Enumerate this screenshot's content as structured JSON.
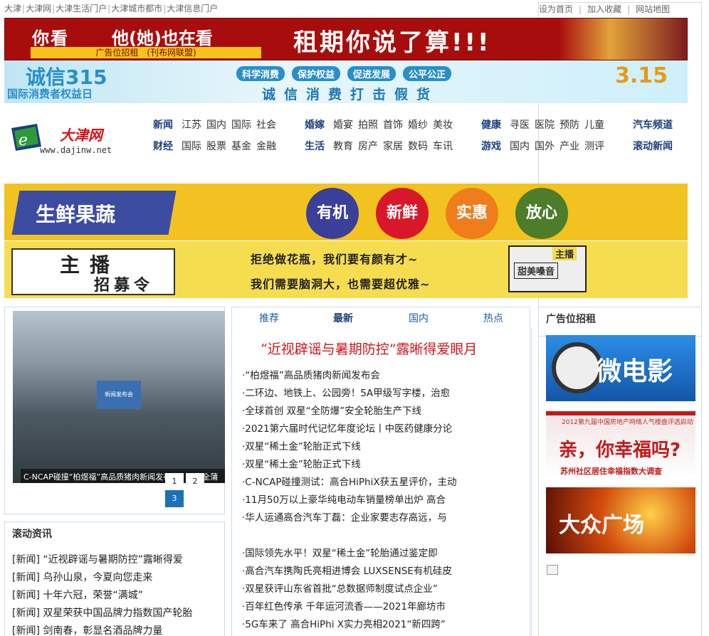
{
  "topbar": {
    "left_links": [
      "大津",
      "大津网",
      "大津生活门户",
      "大津城市都市",
      "大津信息门户"
    ],
    "right_links": [
      "设为首页",
      "加入收藏",
      "网站地图"
    ]
  },
  "banner_top": {
    "left_text_1": "你看",
    "left_text_2": "他(她)也在看",
    "ad_label": "广告位招租　(刊布网联盟)",
    "slogan": "租期你说了算!!!"
  },
  "banner_315": {
    "title": "诚信315",
    "subtitle": "国际消费者权益日",
    "pills": [
      "科学消费",
      "保护权益",
      "促进发展",
      "公平公正"
    ],
    "slogan": "诚信消费打击假货",
    "badge": "3.15"
  },
  "logo": {
    "name": "大津网",
    "url": "www.dajinw.net"
  },
  "nav": [
    {
      "rows": [
        {
          "cat": "新闻",
          "subs": [
            "江苏",
            "国内",
            "国际",
            "社会"
          ]
        },
        {
          "cat": "财经",
          "subs": [
            "国际",
            "股票",
            "基金",
            "金融"
          ]
        }
      ]
    },
    {
      "rows": [
        {
          "cat": "婚嫁",
          "subs": [
            "婚宴",
            "拍照",
            "首饰",
            "婚纱",
            "美妆"
          ]
        },
        {
          "cat": "生活",
          "subs": [
            "教育",
            "房产",
            "家居",
            "数码",
            "车讯"
          ]
        }
      ]
    },
    {
      "rows": [
        {
          "cat": "健康",
          "subs": [
            "寻医",
            "医院",
            "预防",
            "儿童"
          ]
        },
        {
          "cat": "游戏",
          "subs": [
            "国内",
            "国外",
            "产业",
            "测评"
          ]
        }
      ]
    },
    {
      "rows": [
        {
          "cat": "汽车频道",
          "subs": []
        },
        {
          "cat": "滚动新闻",
          "subs": []
        }
      ]
    }
  ],
  "banner_fresh": {
    "label": "生鲜果蔬",
    "circles": [
      "有机",
      "新鲜",
      "实惠",
      "放心"
    ]
  },
  "banner_anchor": {
    "title_1": "主播",
    "title_2": "招募令",
    "line_1": "拒绝做花瓶，我们要有颜有才~",
    "line_2": "我们需要脑洞大，也需要超优雅~",
    "tag_1": "主播",
    "tag_2": "甜美嗓音"
  },
  "slider": {
    "screen_text": "新闻发布会",
    "caption": "C-NCAP碰撞“柏煜福”高品质猪肉新闻发布会：动安全蒲",
    "dots": [
      "1",
      "2",
      "3"
    ],
    "active_dot": 3
  },
  "scroll_news": {
    "title": "滚动资讯",
    "items": [
      "[新闻] “近视辟谣与暑期防控”露晰得爱",
      "[新闻] 乌孙山泉，今夏向您走来",
      "[新闻] 十年六冠，荣誉“满城”",
      "[新闻] 双星荣获中国品牌力指数国产轮胎",
      "[新闻] 剑南春，彰显名酒品牌力量"
    ]
  },
  "center": {
    "tabs": [
      "推荐",
      "最新",
      "国内",
      "热点"
    ],
    "active_tab": 1,
    "headline": "“近视辟谣与暑期防控”露晰得爱眼月",
    "news_1": [
      "·“柏煜福”高品质猪肉新闻发布会",
      "·二环边、地铁上、公园旁！5A甲级写字楼，治愈",
      "·全球首创 双星“全防爆”安全轮胎生产下线",
      "·2021第六届时代记忆年度论坛丨中医药健康分论",
      "·双星“稀土金”轮胎正式下线",
      "·双星“稀土金”轮胎正式下线",
      "·C-NCAP碰撞测试：高合HiPhiX获五星评价，主动",
      "·11月50万以上豪华纯电动车销量榜单出炉 高合",
      "·华人运通高合汽车丁磊：企业家要志存高远，与"
    ],
    "news_2": [
      "·国际领先水平！双星“稀土金”轮胎通过鉴定即",
      "·高合汽车携陶氏亮相进博会 LUXSENSE有机硅皮",
      "·双星获评山东省首批“总数据师制度试点企业”",
      "·百年红色传承 千年运河流香——2021年廊坊市",
      "·5G车来了 高合HiPhi X实力亮相2021“新四跨”"
    ]
  },
  "right": {
    "title": "广告位招租",
    "ad1": "微电影",
    "ad2_top": "2012第九届中国房地产网络人气楼盘评选启动",
    "ad2": "亲，你幸福吗?",
    "ad2_sub": "苏州社区居住幸福指数大调查",
    "ad3": "大众广场"
  },
  "colors": {
    "nav_blue": "#1d3f7e",
    "headline_red": "#d0151c",
    "link_blue": "#1c5ea8",
    "border": "#cfdbe6"
  }
}
